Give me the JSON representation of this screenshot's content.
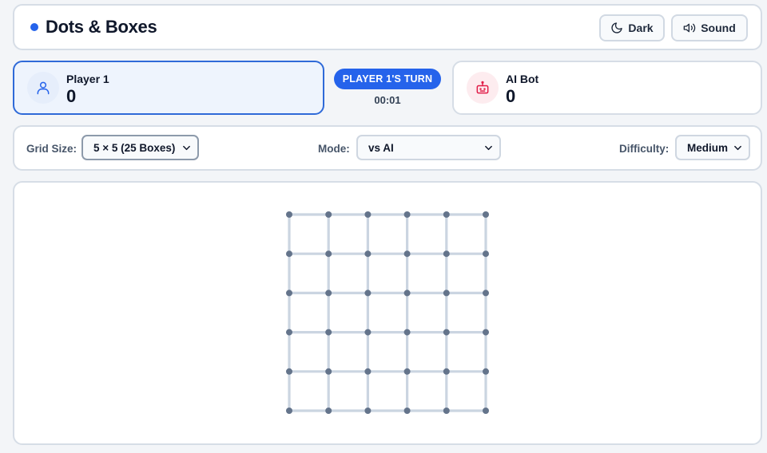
{
  "header": {
    "title": "Dots & Boxes",
    "dark_label": "Dark",
    "sound_label": "Sound"
  },
  "players": {
    "p1": {
      "name": "Player 1",
      "score": "0"
    },
    "ai": {
      "name": "AI Bot",
      "score": "0"
    }
  },
  "turn": {
    "label": "PLAYER 1'S TURN",
    "timer": "00:01"
  },
  "controls": {
    "grid_label": "Grid Size:",
    "grid_value": "5 × 5 (25 Boxes)",
    "mode_label": "Mode:",
    "mode_value": "vs AI",
    "difficulty_label": "Difficulty:",
    "difficulty_value": "Medium"
  },
  "board": {
    "rows": 5,
    "cols": 5
  },
  "colors": {
    "accent": "#2563eb",
    "active_border": "#2f6ad8",
    "active_bg": "#eef4fd",
    "line": "#cbd5e1",
    "dot": "#64748b",
    "ai_icon": "#e11d48"
  },
  "icons": {
    "brand": "dot-icon",
    "dark": "moon-icon",
    "sound": "speaker-icon",
    "player": "user-icon",
    "ai": "robot-icon",
    "select": "chevron-down-icon"
  }
}
